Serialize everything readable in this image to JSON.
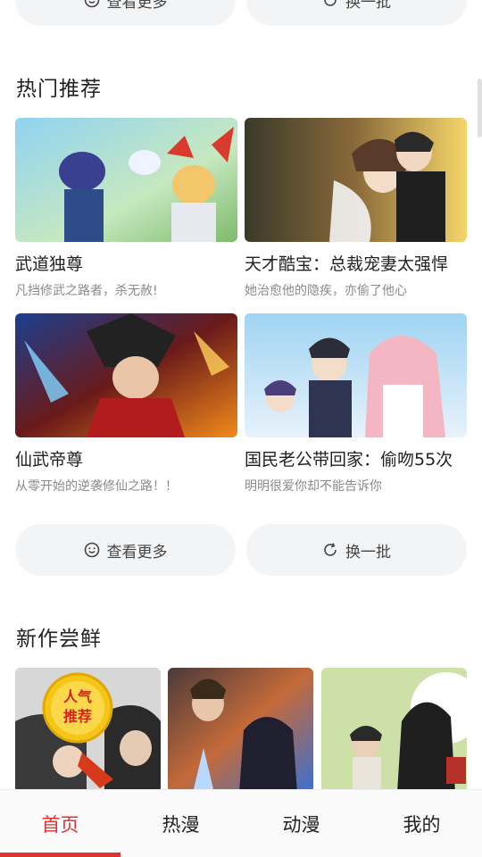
{
  "top_buttons": {
    "more_label": "查看更多",
    "refresh_label": "换一批"
  },
  "hot": {
    "title": "热门推荐",
    "items": [
      {
        "title": "武道独尊",
        "subtitle": "凡挡修武之路者，杀无赦!"
      },
      {
        "title": "天才酷宝：总裁宠妻太强悍",
        "subtitle": "她治愈他的隐疾，亦偷了他心"
      },
      {
        "title": "仙武帝尊",
        "subtitle": "从零开始的逆袭修仙之路！！"
      },
      {
        "title": "国民老公带回家：偷吻55次",
        "subtitle": "明明很爱你却不能告诉你"
      }
    ],
    "more_label": "查看更多",
    "refresh_label": "换一批"
  },
  "new": {
    "title": "新作尝鲜",
    "badge_text": "人气推荐"
  },
  "nav": {
    "items": [
      "首页",
      "热漫",
      "动漫",
      "我的"
    ],
    "active": "首页"
  },
  "colors": {
    "accent": "#e0322f",
    "pill_bg": "#f3f4f6"
  }
}
